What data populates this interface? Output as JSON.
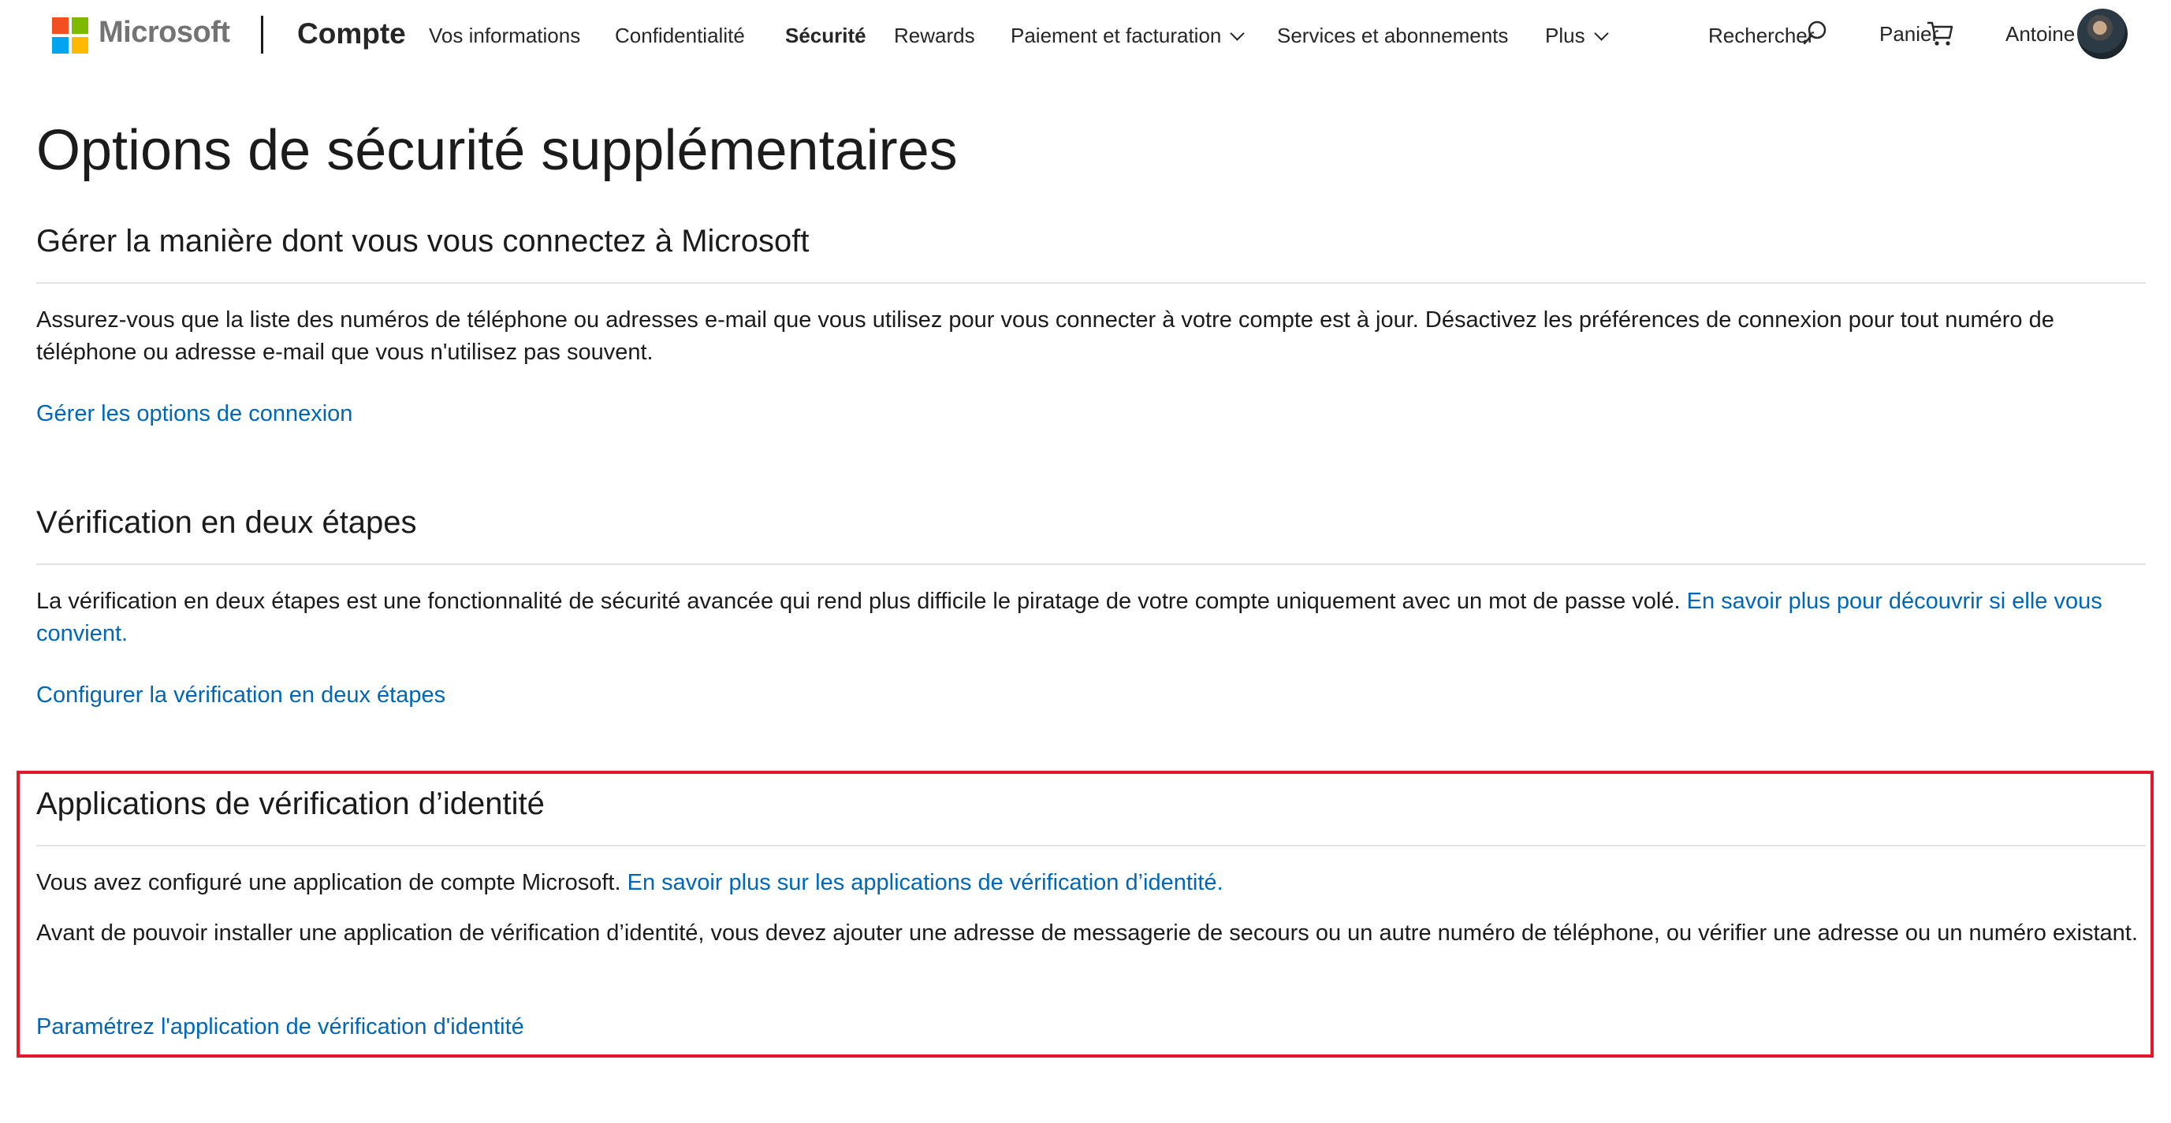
{
  "header": {
    "brand": "Microsoft",
    "product": "Compte",
    "logo_colors": [
      "#f25022",
      "#7fba00",
      "#00a4ef",
      "#ffb900"
    ],
    "nav": [
      {
        "label": "Vos informations",
        "active": false,
        "dropdown": false
      },
      {
        "label": "Confidentialité",
        "active": false,
        "dropdown": false
      },
      {
        "label": "Sécurité",
        "active": true,
        "dropdown": false
      },
      {
        "label": "Rewards",
        "active": false,
        "dropdown": false
      },
      {
        "label": "Paiement et facturation",
        "active": false,
        "dropdown": true
      },
      {
        "label": "Services et abonnements",
        "active": false,
        "dropdown": false
      },
      {
        "label": "Plus",
        "active": false,
        "dropdown": true
      }
    ],
    "search_label": "Rechercher",
    "cart_label": "Panier",
    "user_name": "Antoine"
  },
  "page": {
    "title": "Options de sécurité supplémentaires"
  },
  "sections": {
    "signin": {
      "heading": "Gérer la manière dont vous vous connectez à Microsoft",
      "text": "Assurez-vous que la liste des numéros de téléphone ou adresses e-mail que vous utilisez pour vous connecter à votre compte est à jour. Désactivez les préférences de connexion pour tout numéro de téléphone ou adresse e-mail que vous n'utilisez pas souvent.",
      "link": "Gérer les options de connexion"
    },
    "two_step": {
      "heading": "Vérification en deux étapes",
      "text": "La vérification en deux étapes est une fonctionnalité de sécurité avancée qui rend plus difficile le piratage de votre compte uniquement avec un mot de passe volé.",
      "inline_link": "En savoir plus pour découvrir si elle vous convient.",
      "link": "Configurer la vérification en deux étapes"
    },
    "identity_apps": {
      "heading": "Applications de vérification d’identité",
      "text1": "Vous avez configuré une application de compte Microsoft.",
      "inline_link": "En savoir plus sur les applications de vérification d’identité.",
      "text2": "Avant de pouvoir installer une application de vérification d’identité, vous devez ajouter une adresse de messagerie de secours ou un autre numéro de téléphone, ou vérifier une adresse ou un numéro existant.",
      "link": "Paramétrez l'application de vérification d'identité"
    }
  },
  "colors": {
    "link": "#0067b8",
    "highlight_border": "#e3182d",
    "divider": "#e2e2e2"
  }
}
